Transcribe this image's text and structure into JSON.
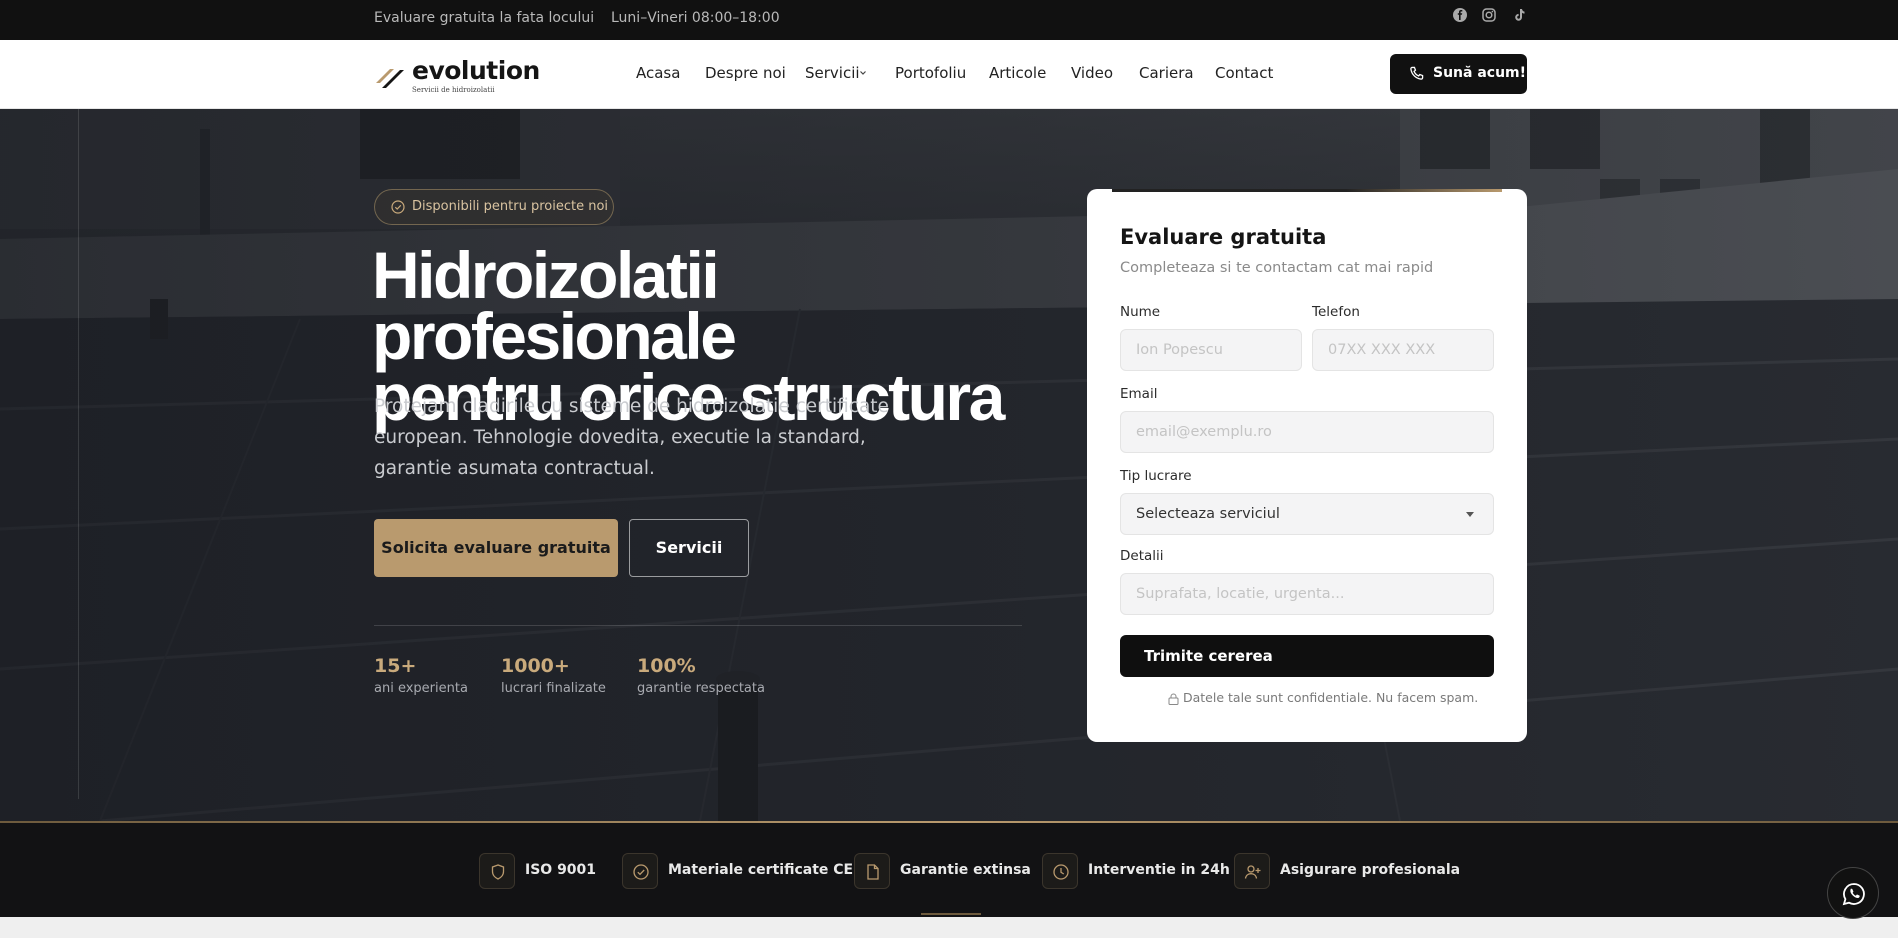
{
  "topbar": {
    "left_text": "Evaluare gratuita la fata locului",
    "hours": "Luni–Vineri 08:00–18:00",
    "socials": [
      "facebook-icon",
      "instagram-icon",
      "tiktok-icon"
    ]
  },
  "nav": {
    "logo_text": "evolution",
    "logo_tagline": "Servicii de hidroizolatii",
    "links": [
      "Acasa",
      "Despre noi",
      "Servicii",
      "Portofoliu",
      "Articole",
      "Video",
      "Cariera",
      "Contact"
    ],
    "call_label": "Sună acum!"
  },
  "hero": {
    "badge": "Disponibili pentru proiecte noi",
    "title_line1": "Hidroizolatii profesionale",
    "title_line2": "pentru orice structura",
    "lead": "Protejam cladirile cu sisteme de hidroizolatie certificate european. Tehnologie dovedita, executie la standard, garantie asumata contractual.",
    "primary_cta": "Solicita evaluare gratuita",
    "secondary_cta": "Servicii",
    "stats": [
      {
        "value": "15+",
        "label": "ani experienta"
      },
      {
        "value": "1000+",
        "label": "lucrari finalizate"
      },
      {
        "value": "100%",
        "label": "garantie respectata"
      }
    ]
  },
  "form": {
    "title": "Evaluare gratuita",
    "subtitle": "Completeaza si te contactam cat mai rapid",
    "name_label": "Nume",
    "name_placeholder": "Ion Popescu",
    "phone_label": "Telefon",
    "phone_placeholder": "07XX XXX XXX",
    "email_label": "Email",
    "email_placeholder": "email@exemplu.ro",
    "type_label": "Tip lucrare",
    "type_value": "Selecteaza serviciul",
    "details_label": "Detalii",
    "details_placeholder": "Suprafata, locatie, urgenta...",
    "submit_label": "Trimite cererea",
    "privacy": "Datele tale sunt confidentiale. Nu facem spam."
  },
  "features": [
    {
      "icon": "shield-icon",
      "label": "ISO 9001"
    },
    {
      "icon": "check-circle-icon",
      "label": "Materiale certificate CE"
    },
    {
      "icon": "document-icon",
      "label": "Garantie extinsa"
    },
    {
      "icon": "clock-icon",
      "label": "Interventie in 24h"
    },
    {
      "icon": "user-plus-icon",
      "label": "Asigurare profesionala"
    }
  ],
  "colors": {
    "accent": "#b99a6e",
    "dark": "#111111",
    "card_bg": "#ffffff"
  }
}
